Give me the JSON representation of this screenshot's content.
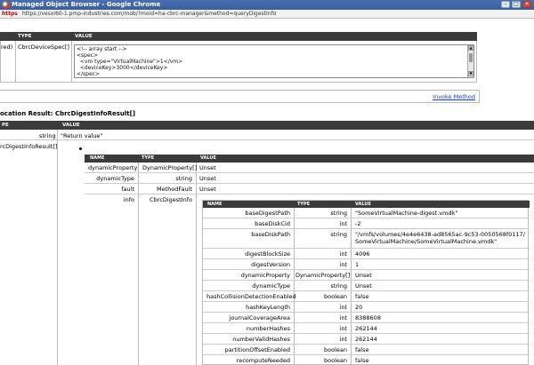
{
  "window": {
    "title": "Managed Object Browser - Google Chrome",
    "minimize": "–",
    "maximize": "□",
    "close": "✕"
  },
  "address": {
    "badge": "https",
    "url": "https://vesxi60-1.pmp-industries.com/mob/?moid=ha-cbrc-manager&method=queryDigestInfo"
  },
  "param_table": {
    "headers": [
      "TYPE",
      "VALUE"
    ],
    "row": {
      "name": "red)",
      "type": "CbrcDeviceSpec[]",
      "xml_value": "<!-- array start -->\n<spec>\n  <vm type=\"VirtualMachine\">1</vm>\n  <deviceKey>3000</deviceKey>\n</spec>"
    }
  },
  "invoke_link": "Invoke Method",
  "result": {
    "title": "ocation Result: CbrcDigestInfoResult[]",
    "headers": [
      "PE",
      "VALUE"
    ],
    "row1": {
      "type": "string",
      "value": "\"Return value\""
    },
    "row2_name": "rcDigestInfoResult[]"
  },
  "level2": {
    "headers": [
      "NAME",
      "TYPE",
      "VALUE"
    ],
    "rows": [
      {
        "name": "dynamicProperty",
        "type": "DynamicProperty[]",
        "value": "Unset"
      },
      {
        "name": "dynamicType",
        "type": "string",
        "value": "Unset"
      },
      {
        "name": "fault",
        "type": "MethodFault",
        "value": "Unset"
      },
      {
        "name": "info",
        "type": "CbrcDigestInfo",
        "value": ""
      }
    ]
  },
  "level3": {
    "headers": [
      "NAME",
      "TYPE",
      "VALUE"
    ],
    "rows": [
      {
        "name": "baseDigestPath",
        "type": "string",
        "value": "\"SomeVirtualMachine-digest.vmdk\""
      },
      {
        "name": "baseDiskCid",
        "type": "int",
        "value": "-2"
      },
      {
        "name": "baseDiskPath",
        "type": "string",
        "value": "\"/vmfs/volumes/4e4e6438-ad8565ac-9c53-0050568f0117/SomeVirtualMachine/SomeVirtualMachine.vmdk\""
      },
      {
        "name": "digestBlockSize",
        "type": "int",
        "value": "4096"
      },
      {
        "name": "digestVersion",
        "type": "int",
        "value": "1"
      },
      {
        "name": "dynamicProperty",
        "type": "DynamicProperty[]",
        "value": "Unset"
      },
      {
        "name": "dynamicType",
        "type": "string",
        "value": "Unset"
      },
      {
        "name": "hashCollisionDetectionEnabled",
        "type": "boolean",
        "value": "false"
      },
      {
        "name": "hashKeyLength",
        "type": "int",
        "value": "20"
      },
      {
        "name": "journalCoverageArea",
        "type": "int",
        "value": "8388608"
      },
      {
        "name": "numberHashes",
        "type": "int",
        "value": "262144"
      },
      {
        "name": "numberValidHashes",
        "type": "int",
        "value": "262144"
      },
      {
        "name": "partitionOffsetEnabled",
        "type": "boolean",
        "value": "false"
      },
      {
        "name": "recomputeNeeded",
        "type": "boolean",
        "value": "false"
      }
    ]
  }
}
